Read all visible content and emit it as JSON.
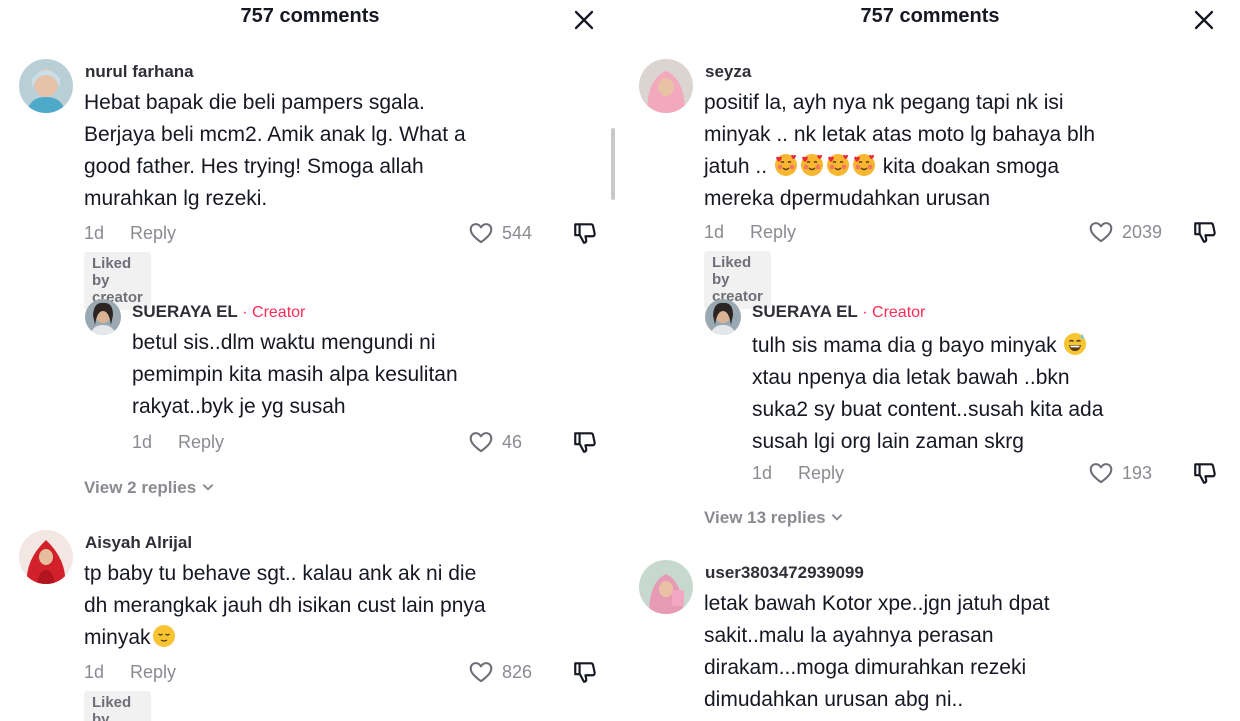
{
  "left": {
    "header": {
      "title": "757 comments"
    },
    "comments": [
      {
        "username": "nurul farhana",
        "lines": [
          "Hebat bapak die beli pampers sgala.",
          "Berjaya beli mcm2. Amik anak lg. What a",
          "good father. Hes trying! Smoga allah",
          "murahkan lg rezeki."
        ],
        "time": "1d",
        "reply_label": "Reply",
        "likes": "544",
        "liked_badge": "Liked by creator"
      },
      {
        "username": "SUERAYA EL",
        "creator_label": "· Creator",
        "lines": [
          "betul sis..dlm waktu mengundi ni",
          "pemimpin kita masih alpa kesulitan",
          "rakyat..byk je yg susah"
        ],
        "time": "1d",
        "reply_label": "Reply",
        "likes": "46"
      },
      {
        "view_replies": "View 2 replies"
      },
      {
        "username": "Aisyah Alrijal",
        "lines": [
          "tp baby tu behave sgt.. kalau ank ak ni die",
          "dh merangkak jauh dh isikan cust lain pnya",
          "minyak"
        ],
        "time": "1d",
        "reply_label": "Reply",
        "likes": "826",
        "liked_badge": "Liked by creator"
      }
    ]
  },
  "right": {
    "header": {
      "title": "757 comments"
    },
    "comments": [
      {
        "username": "seyza",
        "lines": [
          "positif la, ayh nya nk pegang tapi nk isi",
          "minyak .. nk letak atas moto lg bahaya blh",
          "jatuh ..",
          "kita doakan smoga",
          "mereka dpermudahkan urusan"
        ],
        "time": "1d",
        "reply_label": "Reply",
        "likes": "2039",
        "liked_badge": "Liked by creator"
      },
      {
        "username": "SUERAYA EL",
        "creator_label": "· Creator",
        "lines": [
          "tulh sis mama dia g bayo minyak",
          "xtau npenya dia letak bawah ..bkn",
          "suka2 sy buat content..susah kita ada",
          "susah lgi org lain zaman skrg"
        ],
        "time": "1d",
        "reply_label": "Reply",
        "likes": "193"
      },
      {
        "view_replies": "View 13 replies"
      },
      {
        "username": "user3803472939099",
        "lines": [
          "letak bawah Kotor xpe..jgn jatuh dpat",
          "sakit..malu la ayahnya perasan",
          "dirakam...moga dimurahkan rezeki",
          "dimudahkan urusan abg ni.."
        ]
      }
    ]
  },
  "icons": {
    "close": "close-icon",
    "heart": "heart-outline-icon",
    "dislike": "thumbs-down-icon",
    "chevron": "chevron-down-icon",
    "emoji_relieved": "relieved-face-emoji",
    "emoji_hearts": "smiling-face-with-hearts-emoji",
    "emoji_sweat": "grinning-face-with-sweat-emoji"
  },
  "colors": {
    "creator": "#fe2c55",
    "text": "#161823",
    "muted": "#8a8b91",
    "badge_bg": "#f1f1f2"
  }
}
